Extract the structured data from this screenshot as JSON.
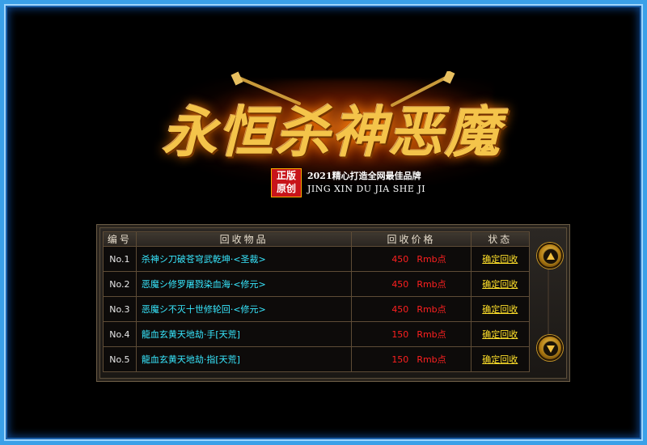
{
  "logo": {
    "title": "永恒杀神恶魔",
    "badge_line1": "正版",
    "badge_line2": "原创",
    "slogan": "2021精心打造全网最佳品牌",
    "pinyin": "JING XIN DU JIA SHE JI"
  },
  "table": {
    "headers": [
      "编号",
      "回收物品",
      "回收价格",
      "状态"
    ],
    "rows": [
      {
        "no": "No.1",
        "item": "杀神シ刀破苍穹武乾坤·<圣裁>",
        "price": "450",
        "unit": "Rmb点",
        "action": "确定回收"
      },
      {
        "no": "No.2",
        "item": "恶魔シ修罗屠戮染血海·<修元>",
        "price": "450",
        "unit": "Rmb点",
        "action": "确定回收"
      },
      {
        "no": "No.3",
        "item": "恶魔シ不灭十世修轮回·<修元>",
        "price": "450",
        "unit": "Rmb点",
        "action": "确定回收"
      },
      {
        "no": "No.4",
        "item": "龍血玄黄天地劫·手[天荒]",
        "price": "150",
        "unit": "Rmb点",
        "action": "确定回收"
      },
      {
        "no": "No.5",
        "item": "龍血玄黄天地劫·指[天荒]",
        "price": "150",
        "unit": "Rmb点",
        "action": "确定回收"
      }
    ]
  },
  "scroll": {
    "up_icon": "scroll-up-icon",
    "down_icon": "scroll-down-icon"
  },
  "colors": {
    "item_text": "#38e8ff",
    "price_text": "#ff2020",
    "action_text": "#ffe02a",
    "frame": "#3aa0e8"
  }
}
